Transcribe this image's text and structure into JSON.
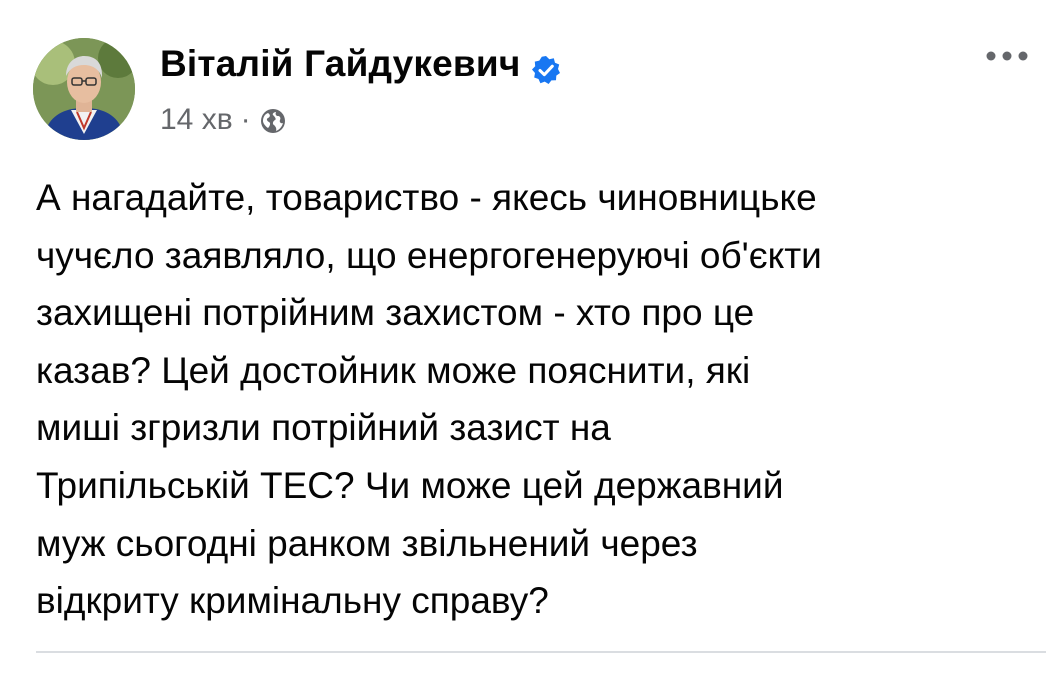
{
  "post": {
    "author_name": "Віталій Гайдукевич",
    "timestamp": "14 хв",
    "separator": "·",
    "privacy_icon": "globe-icon",
    "verified_icon": "verified-badge-icon",
    "more_icon": "more-options-icon",
    "text": "А нагадайте, товариство - якесь чиновницьке\nчучєло заявляло, що енергогенеруючі об'єкти\nзахищені потрійним захистом - хто про це\nказав? Цей достойник може пояснити, які\nмиші згризли потрійний зазист на\nТрипільській ТЕС? Чи може цей державний\nмуж сьогодні ранком звільнений через\nвідкриту кримінальну справу?"
  },
  "colors": {
    "verified": "#1877f2",
    "meta_text": "#65676b",
    "body_text": "#050505",
    "divider": "#dadde1"
  }
}
